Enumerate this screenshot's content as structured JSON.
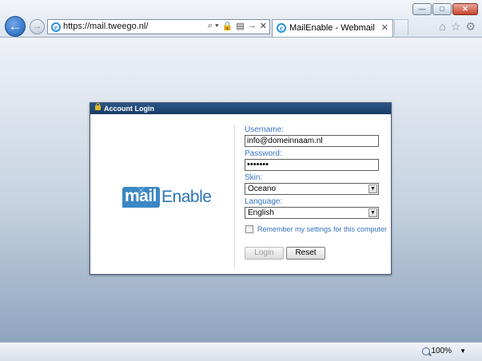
{
  "browser": {
    "window_buttons": {
      "minimize": "—",
      "maximize": "□",
      "close": "✕"
    },
    "back_glyph": "←",
    "forward_glyph": "→",
    "address_url": "https://mail.tweego.nl/",
    "address_tools": {
      "search": "⌕ ▾",
      "lock": "🔒",
      "compat": "▤",
      "go": "→",
      "stop": "✕"
    },
    "tab_title": "MailEnable - Webmail",
    "tab_close": "✕",
    "right_tools": {
      "home": "⌂",
      "favorites": "☆",
      "settings": "⚙"
    }
  },
  "dialog": {
    "title": "Account Login",
    "logo": {
      "part1": "mail",
      "part2": "Enable"
    },
    "username_label": "Username:",
    "username_value": "info@domeinnaam.nl",
    "password_label": "Password:",
    "password_value": "•••••••",
    "skin_label": "Skin:",
    "skin_value": "Oceano",
    "language_label": "Language:",
    "language_value": "English",
    "remember_label": "Remember my settings for this computer",
    "login_button": "Login",
    "reset_button": "Reset"
  },
  "statusbar": {
    "zoom": "100%",
    "zoom_caret": "▼"
  },
  "colors": {
    "accent": "#3873bd",
    "header": "#1f4673",
    "logo_blue": "#3b87c4"
  }
}
